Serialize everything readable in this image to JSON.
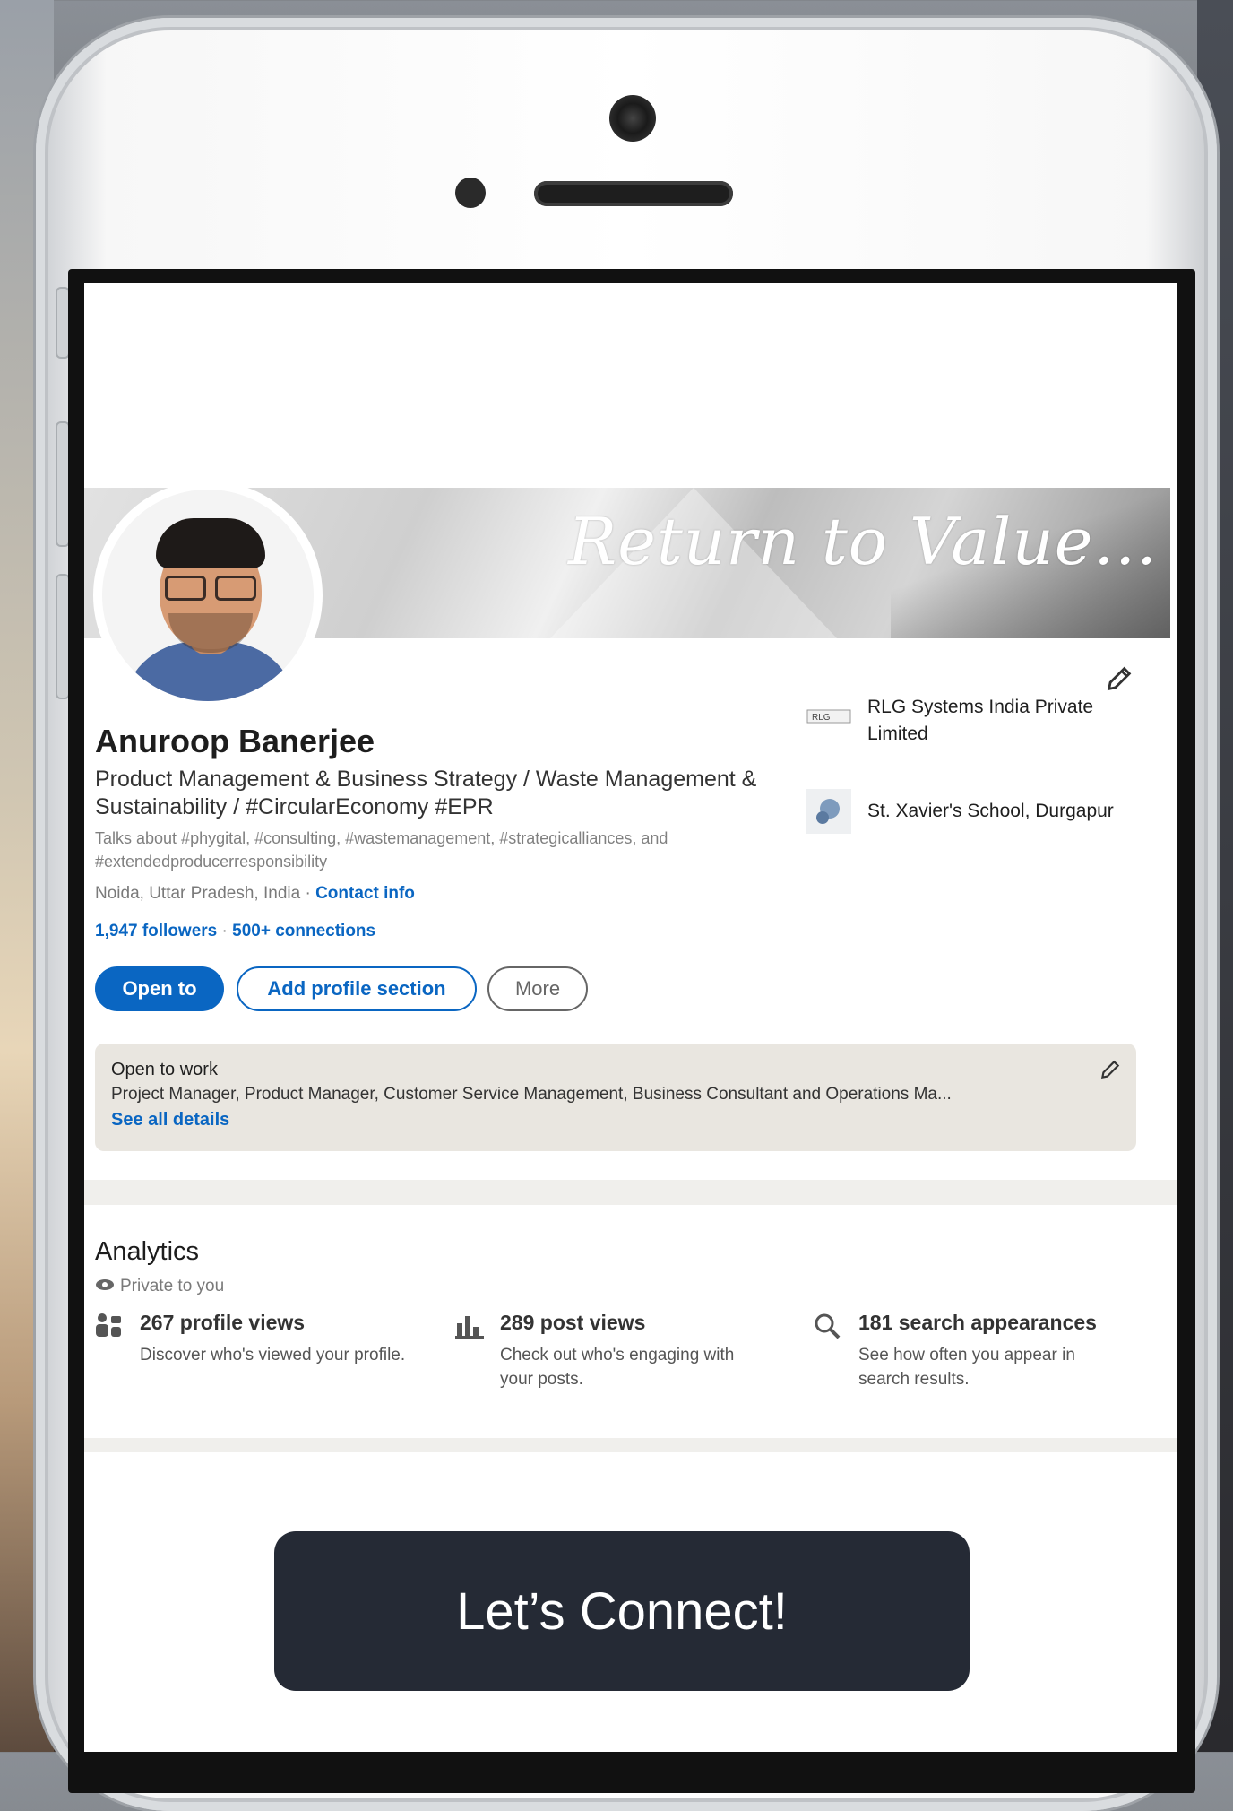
{
  "banner": {
    "text": "Return to Value..."
  },
  "profile": {
    "name": "Anuroop Banerjee",
    "headline": "Product Management & Business Strategy / Waste Management & Sustainability / #CircularEconomy #EPR",
    "talks_about": "Talks about #phygital, #consulting, #wastemanagement, #strategicalliances, and #extendedproducerresponsibility",
    "location": "Noida, Uttar Pradesh, India",
    "location_sep": " · ",
    "contact_info": "Contact info",
    "followers": "1,947 followers",
    "net_sep": " · ",
    "connections": "500+ connections"
  },
  "experience": [
    {
      "label": "RLG Systems India Private Limited",
      "logo_text": "RLG"
    },
    {
      "label": "St. Xavier's School, Durgapur"
    }
  ],
  "actions": {
    "open_to": "Open to",
    "add_profile_section": "Add profile section",
    "more": "More"
  },
  "open_to_work": {
    "title": "Open to work",
    "roles": "Project Manager, Product Manager, Customer Service Management, Business Consultant and Operations Ma...",
    "link": "See all details"
  },
  "analytics": {
    "title": "Analytics",
    "private": "Private to you",
    "items": [
      {
        "title": "267 profile views",
        "desc": "Discover who's viewed your profile.",
        "icon": "people-icon"
      },
      {
        "title": "289 post views",
        "desc": "Check out who's engaging with your posts.",
        "icon": "bar-chart-icon"
      },
      {
        "title": "181 search appearances",
        "desc": "See how often you appear in search results.",
        "icon": "search-icon"
      }
    ]
  },
  "cta": {
    "label": "Let’s Connect!"
  },
  "colors": {
    "accent": "#0a66c2",
    "cta_bg": "#252a35",
    "open_to_work_bg": "#e9e6e0"
  }
}
